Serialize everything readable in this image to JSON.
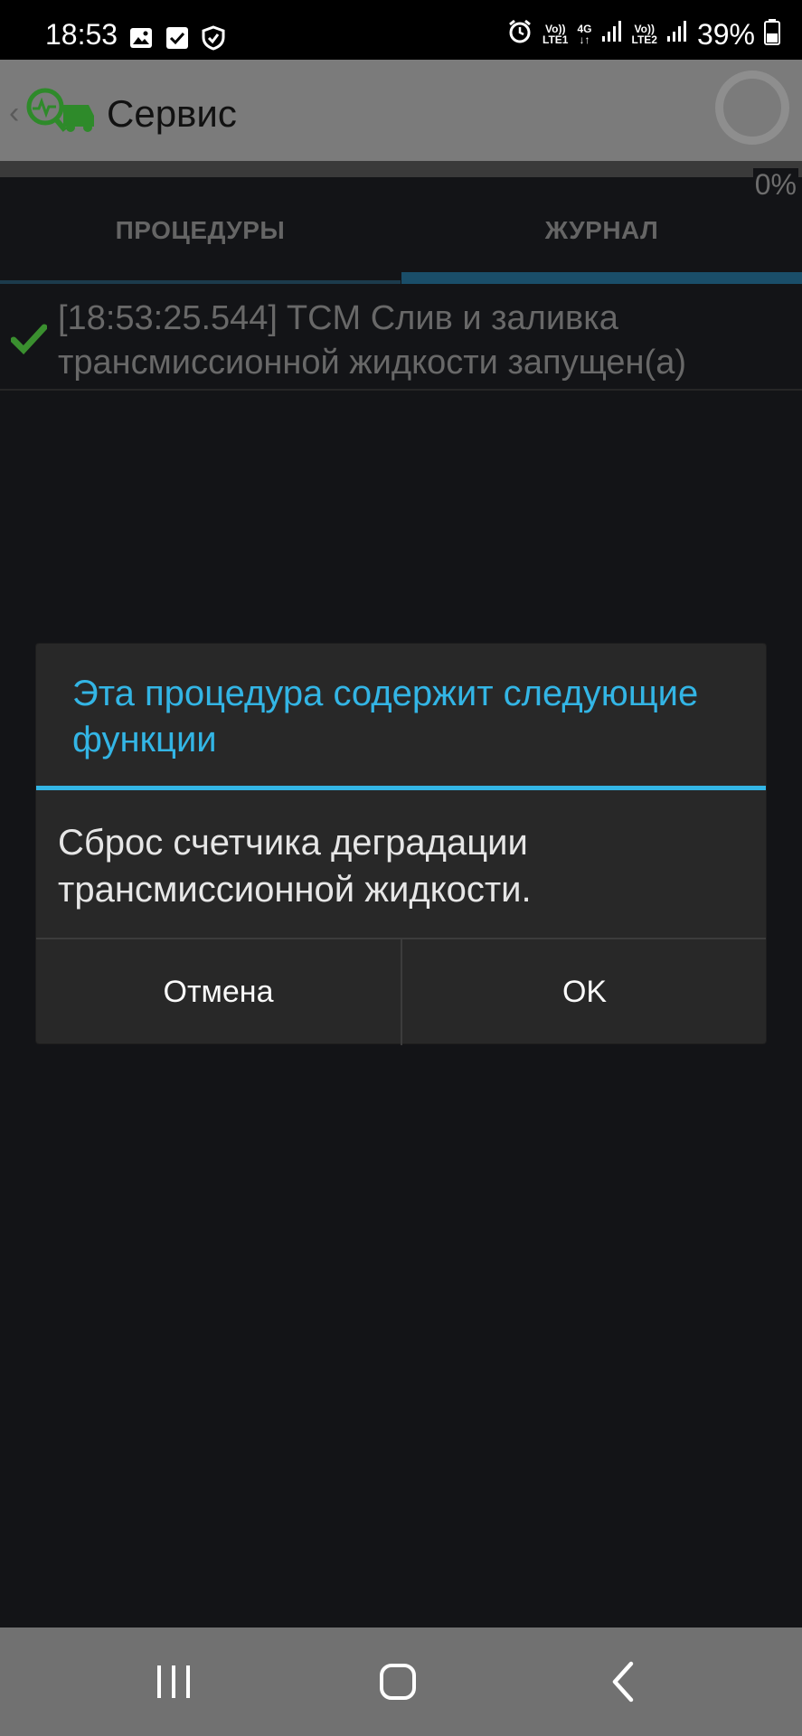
{
  "status_bar": {
    "time": "18:53",
    "icons_left": [
      "image-icon",
      "checkbox-icon",
      "shield-icon"
    ],
    "sim1": {
      "top": "Vo))",
      "bottom": "LTE1"
    },
    "network_type": "4G",
    "sim2": {
      "top": "Vo))",
      "bottom": "LTE2"
    },
    "battery": "39%"
  },
  "app_bar": {
    "title": "Сервис",
    "progress_label": "0%"
  },
  "tabs": [
    {
      "label": "ПРОЦЕДУРЫ",
      "selected": false
    },
    {
      "label": "ЖУРНАЛ",
      "selected": true
    }
  ],
  "journal": {
    "entries": [
      {
        "text": "[18:53:25.544] TCM Слив и заливка трансмиссионной жидкости запущен(а)",
        "status": "success"
      }
    ]
  },
  "dialog": {
    "title": "Эта процедура содержит следующие функции",
    "message": "Сброс счетчика деградации трансмиссионной жидкости.",
    "cancel_label": "Отмена",
    "ok_label": "OK"
  },
  "colors": {
    "accent": "#33b5e5",
    "success": "#3a8f2f",
    "background": "#131417"
  }
}
